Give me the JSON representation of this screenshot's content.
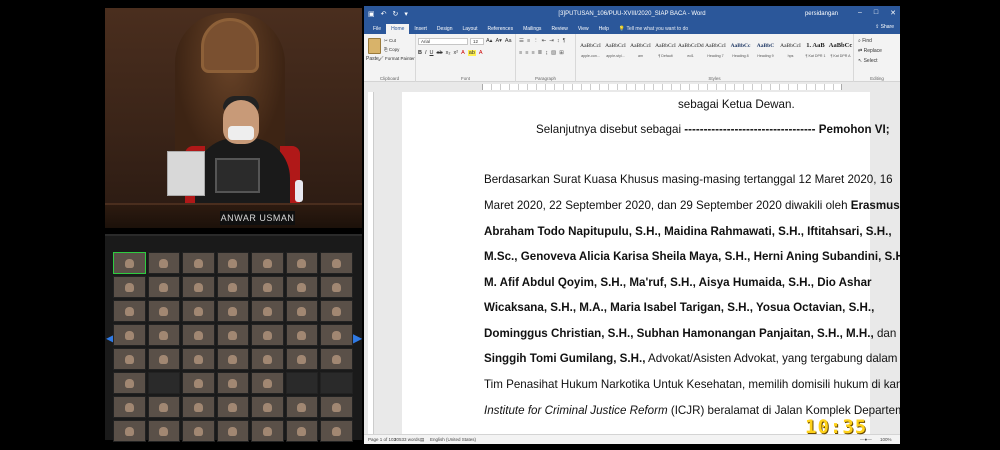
{
  "video": {
    "name_plate": "ANWAR USMAN"
  },
  "gallery": {
    "tiles": [
      {
        "label": "",
        "dark": false,
        "sel": true
      },
      {
        "label": "",
        "dark": false
      },
      {
        "label": "",
        "dark": false
      },
      {
        "label": "",
        "dark": false
      },
      {
        "label": "",
        "dark": false
      },
      {
        "label": "",
        "dark": false
      },
      {
        "label": "",
        "dark": false
      },
      {
        "label": "",
        "dark": false
      },
      {
        "label": "",
        "dark": false
      },
      {
        "label": "",
        "dark": false
      },
      {
        "label": "",
        "dark": false
      },
      {
        "label": "",
        "dark": false
      },
      {
        "label": "",
        "dark": false
      },
      {
        "label": "",
        "dark": false
      },
      {
        "label": "",
        "dark": false
      },
      {
        "label": "",
        "dark": false
      },
      {
        "label": "",
        "dark": false
      },
      {
        "label": "",
        "dark": false
      },
      {
        "label": "",
        "dark": false
      },
      {
        "label": "",
        "dark": false
      },
      {
        "label": "",
        "dark": false
      },
      {
        "label": "",
        "dark": false
      },
      {
        "label": "",
        "dark": false
      },
      {
        "label": "",
        "dark": false
      },
      {
        "label": "",
        "dark": false
      },
      {
        "label": "",
        "dark": false
      },
      {
        "label": "",
        "dark": false
      },
      {
        "label": "",
        "dark": false
      },
      {
        "label": "",
        "dark": false
      },
      {
        "label": "",
        "dark": false
      },
      {
        "label": "",
        "dark": false
      },
      {
        "label": "",
        "dark": false
      },
      {
        "label": "",
        "dark": false
      },
      {
        "label": "",
        "dark": false
      },
      {
        "label": "",
        "dark": false
      },
      {
        "label": "",
        "dark": false
      },
      {
        "label": "",
        "dark": true
      },
      {
        "label": "",
        "dark": false
      },
      {
        "label": "",
        "dark": false
      },
      {
        "label": "",
        "dark": false
      },
      {
        "label": "",
        "dark": true
      },
      {
        "label": "",
        "dark": true
      },
      {
        "label": "",
        "dark": false
      },
      {
        "label": "",
        "dark": false
      },
      {
        "label": "",
        "dark": false
      },
      {
        "label": "",
        "dark": false
      },
      {
        "label": "",
        "dark": false
      },
      {
        "label": "",
        "dark": false
      },
      {
        "label": "",
        "dark": false
      },
      {
        "label": "",
        "dark": false
      },
      {
        "label": "",
        "dark": false
      },
      {
        "label": "",
        "dark": false
      },
      {
        "label": "",
        "dark": false
      },
      {
        "label": "",
        "dark": false
      },
      {
        "label": "",
        "dark": false
      },
      {
        "label": "",
        "dark": false
      }
    ]
  },
  "word": {
    "title": "[3]PUTUSAN_106/PUU-XVIII/2020_SIAP BACA  -  Word",
    "user": "persidangan",
    "tabs": [
      "File",
      "Home",
      "Insert",
      "Design",
      "Layout",
      "References",
      "Mailings",
      "Review",
      "View",
      "Help"
    ],
    "tell_me": "Tell me what you want to do",
    "share": "Share",
    "clipboard": {
      "paste": "Paste",
      "cut": "Cut",
      "copy": "Copy",
      "format_painter": "Format Painter",
      "label": "Clipboard"
    },
    "font": {
      "name": "Arial",
      "size": "12",
      "label": "Font"
    },
    "paragraph_label": "Paragraph",
    "styles": [
      {
        "sample": "AaBbCcI",
        "name": "apple-con..."
      },
      {
        "sample": "AaBbCcI",
        "name": "apple-styl..."
      },
      {
        "sample": "AaBbCcI",
        "name": "am"
      },
      {
        "sample": "AaBbCcI",
        "name": "¶ Default"
      },
      {
        "sample": "AaBbCcDd",
        "name": "ecl1"
      },
      {
        "sample": "AaBbCcI",
        "name": "Heading 7"
      },
      {
        "sample": "AaBbCc",
        "name": "Heading 8"
      },
      {
        "sample": "AaBbC",
        "name": "Heading 9"
      },
      {
        "sample": "AaBbCcI",
        "name": "hps"
      },
      {
        "sample": "1. AaB",
        "name": "¶ Kat DPR 1"
      },
      {
        "sample": "AaBbCc",
        "name": "¶ Kat DPR A"
      }
    ],
    "styles_label": "Styles",
    "editing": {
      "find": "Find",
      "replace": "Replace",
      "select": "Select",
      "label": "Editing"
    },
    "document": {
      "line1": "sebagai Ketua Dewan.",
      "line2_pre": "Selanjutnya disebut sebagai ",
      "line2_dash": "----------------------------------",
      "line2_bold": " Pemohon VI;",
      "p1": "Berdasarkan Surat Kuasa Khusus masing-masing tertanggal 12 Maret 2020, 16",
      "p2": "Maret 2020, 22 September 2020, dan 29 September 2020 diwakili oleh ",
      "p2b": "Erasmus",
      "p3": "Abraham Todo Napitupulu, S.H., Maidina Rahmawati, S.H., Iftitahsari, S.H.,",
      "p4": "M.Sc., Genoveva Alicia Karisa Sheila Maya, S.H., Herni Aning Subandini, S.H.,",
      "p5": "M. Afif Abdul Qoyim, S.H., Ma'ruf, S.H., Aisya Humaida, S.H., Dio Ashar",
      "p6": "Wicaksana, S.H., M.A., Maria Isabel Tarigan, S.H., Yosua Octavian, S.H.,",
      "p7b": "Dominggus Christian, S.H., Subhan Hamonangan Panjaitan, S.H., M.H.,",
      "p7": " dan",
      "p8b": "Singgih Tomi Gumilang, S.H.,",
      "p8": " Advokat/Asisten Advokat, yang tergabung dalam",
      "p9": "Tim Penasihat Hukum Narkotika Untuk Kesehatan, memilih domisili hukum di kantor",
      "p10i": "Institute for Criminal Justice Reform",
      "p10": " (ICJR) beralamat di Jalan Komplek Departemen"
    },
    "status": {
      "page": "Page 1 of 103",
      "words": "30533 words",
      "lang": "English (United States)",
      "zoom": "100%"
    }
  },
  "clock": "10:35"
}
